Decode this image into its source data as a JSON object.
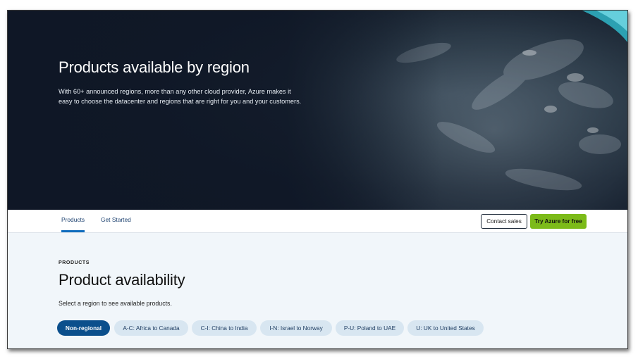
{
  "hero": {
    "title": "Products available by region",
    "description": "With 60+ announced regions, more than any other cloud provider, Azure makes it easy to choose the datacenter and regions that are right for you and your customers."
  },
  "nav": {
    "tabs": [
      {
        "label": "Products",
        "active": true
      },
      {
        "label": "Get Started",
        "active": false
      }
    ],
    "contact_label": "Contact sales",
    "try_label": "Try Azure for free"
  },
  "products": {
    "eyebrow": "PRODUCTS",
    "title": "Product availability",
    "description": "Select a region to see available products.",
    "regions": [
      {
        "label": "Non-regional",
        "selected": true
      },
      {
        "label": "A-C: Africa to Canada",
        "selected": false
      },
      {
        "label": "C-I: China to India",
        "selected": false
      },
      {
        "label": "I-N: Israel to Norway",
        "selected": false
      },
      {
        "label": "P-U: Poland to UAE",
        "selected": false
      },
      {
        "label": "U: UK to United States",
        "selected": false
      }
    ]
  },
  "colors": {
    "accent_blue": "#0f6cbd",
    "selected_pill": "#0b4f8c",
    "pill": "#d8e6f1",
    "try_button": "#7cbb19",
    "hero_dark": "#0f1726"
  }
}
